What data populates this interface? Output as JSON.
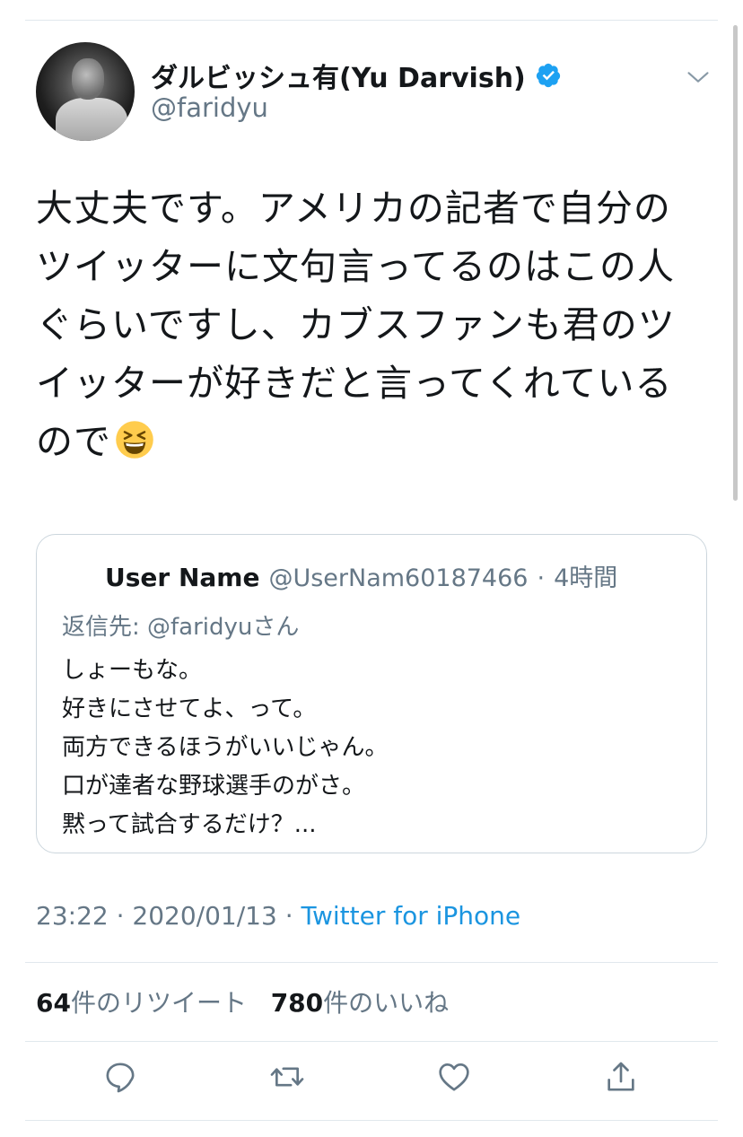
{
  "author": {
    "display_name": "ダルビッシュ有(Yu Darvish)",
    "handle": "@faridyu",
    "verified": true,
    "verified_color": "#1da1f2"
  },
  "tweet": {
    "lines": [
      "大丈夫です。アメリカの記者で自分の",
      "ツイッターに文句言ってるのはこの人",
      "ぐらいですし、カブスファンも君のツ",
      "イッターが好きだと言ってくれている",
      "ので"
    ],
    "emoji": "grinning-squinting-face"
  },
  "quoted_tweet": {
    "name": "User Name",
    "handle": "@UserNam60187466",
    "separator": "·",
    "time": "4時間",
    "reply_to": "返信先: @faridyuさん",
    "lines": [
      "しょーもな。",
      "好きにさせてよ、って。",
      "両方できるほうがいいじゃん。",
      "口が達者な野球選手のがさ。",
      "黙って試合するだけ？..."
    ]
  },
  "meta": {
    "time": "23:22",
    "date": "2020/01/13",
    "sep": " · ",
    "source": "Twitter for iPhone"
  },
  "stats": {
    "retweets": "64",
    "retweets_label": "件のリツイート",
    "likes": "780",
    "likes_label": "件のいいね"
  },
  "actions": [
    "reply-icon",
    "retweet-icon",
    "like-icon",
    "share-icon"
  ],
  "colors": {
    "text": "#14171a",
    "secondary": "#657786",
    "link": "#1b95e0",
    "border": "#e1e8ed"
  }
}
